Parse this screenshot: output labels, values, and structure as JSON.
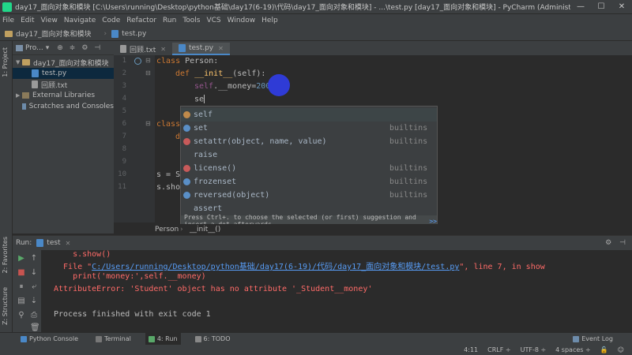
{
  "window": {
    "title": "day17_面向对象和模块 [C:\\Users\\running\\Desktop\\python基础\\day17(6-19)\\代码\\day17_面向对象和模块] - ...\\test.py [day17_面向对象和模块] - PyCharm (Administrator)",
    "minimize": "—",
    "maximize": "☐",
    "close": "✕"
  },
  "menu": [
    "File",
    "Edit",
    "View",
    "Navigate",
    "Code",
    "Refactor",
    "Run",
    "Tools",
    "VCS",
    "Window",
    "Help"
  ],
  "navbar": {
    "folder": "day17_面向对象和模块",
    "file": "test.py"
  },
  "left_strip": {
    "project": "1: Project",
    "favorites": "2: Favorites",
    "structure": "Z: Structure"
  },
  "project": {
    "title": "Pro...",
    "root": "day17_面向对象和模块",
    "file1": "test.py",
    "file2": "回顾.txt",
    "external": "External Libraries",
    "scratches": "Scratches and Consoles"
  },
  "tabs": [
    {
      "label": "回顾.txt"
    },
    {
      "label": "test.py"
    }
  ],
  "code": {
    "line_numbers": [
      "1",
      "2",
      "3",
      "4",
      "5",
      "6",
      "7",
      "8",
      "9",
      "10",
      "11"
    ],
    "l1_kw": "class ",
    "l1_rest": "Person:",
    "l2_kw": "def ",
    "l2_fn": "__init__",
    "l2_rest": "(self):",
    "l3_self": "self",
    "l3_rest": ".__money=",
    "l3_num": "200",
    "l4": "se",
    "l6": "class",
    "l7": "d",
    "l10": "s = S",
    "l11": "s.sho"
  },
  "autocomplete": {
    "items": [
      {
        "name": "self",
        "source": ""
      },
      {
        "name": "set",
        "source": "builtins"
      },
      {
        "name": "setattr(object, name, value)",
        "source": "builtins"
      },
      {
        "name": "raise",
        "source": ""
      },
      {
        "name": "license()",
        "source": "builtins"
      },
      {
        "name": "frozenset",
        "source": "builtins"
      },
      {
        "name": "reversed(object)",
        "source": "builtins"
      },
      {
        "name": "assert",
        "source": ""
      }
    ],
    "hint": "Press Ctrl+. to choose the selected (or first) suggestion and insert a dot afterwards",
    "hint_link": ">>"
  },
  "breadcrumb": {
    "cls": "Person",
    "sep": "›",
    "method": "__init__()"
  },
  "run": {
    "label": "Run:",
    "config": "test",
    "lines": {
      "l0": "    s.show()",
      "l1_pre": "  File \"",
      "l1_path": "C:/Users/running/Desktop/python基础/day17(6-19)/代码/day17_面向对象和模块/test.py",
      "l1_post": "\", line 7, in show",
      "l2": "    print('money:',self.__money)",
      "l3": "AttributeError: 'Student' object has no attribute '_Student__money'",
      "l4": "",
      "l5": "Process finished with exit code 1"
    }
  },
  "bottom_tabs": [
    "Python Console",
    "Terminal",
    "4: Run",
    "6: TODO"
  ],
  "event_log": "Event Log",
  "status": {
    "pos": "4:11",
    "eol": "CRLF ÷",
    "enc": "UTF-8 ÷",
    "indent": "4 spaces ÷"
  }
}
